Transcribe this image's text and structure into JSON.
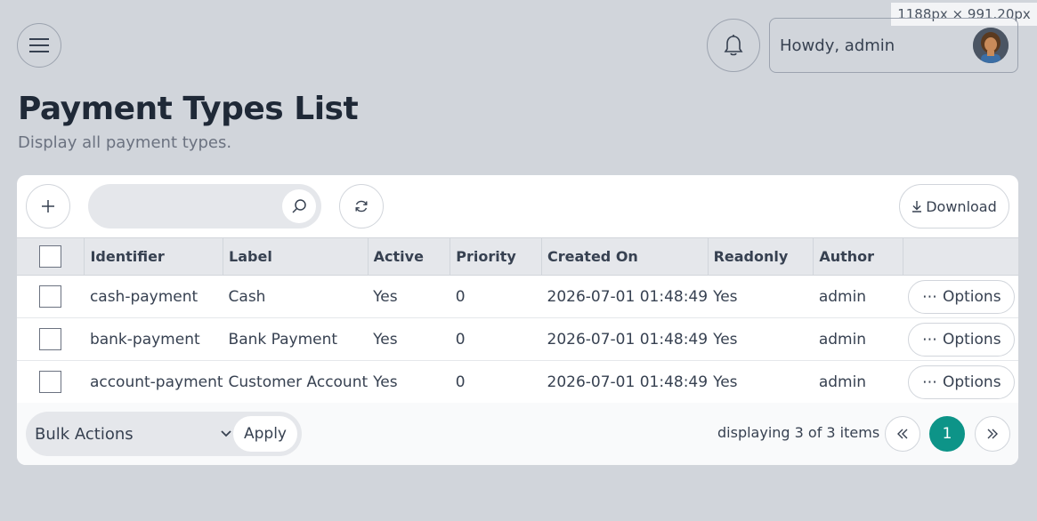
{
  "dimension_badge": "1188px × 991.20px",
  "header": {
    "greeting": "Howdy, admin"
  },
  "page": {
    "title": "Payment Types List",
    "subtitle": "Display all payment types."
  },
  "toolbar": {
    "search_placeholder": "",
    "download_label": "Download"
  },
  "table": {
    "columns": [
      "Identifier",
      "Label",
      "Active",
      "Priority",
      "Created On",
      "Readonly",
      "Author"
    ],
    "rows": [
      {
        "identifier": "cash-payment",
        "label": "Cash",
        "active": "Yes",
        "priority": "0",
        "created_on": "2026-07-01 01:48:49",
        "readonly": "Yes",
        "author": "admin",
        "options": "Options"
      },
      {
        "identifier": "bank-payment",
        "label": "Bank Payment",
        "active": "Yes",
        "priority": "0",
        "created_on": "2026-07-01 01:48:49",
        "readonly": "Yes",
        "author": "admin",
        "options": "Options"
      },
      {
        "identifier": "account-payment",
        "label": "Customer Account",
        "active": "Yes",
        "priority": "0",
        "created_on": "2026-07-01 01:48:49",
        "readonly": "Yes",
        "author": "admin",
        "options": "Options"
      }
    ]
  },
  "footer": {
    "bulk_actions": "Bulk Actions",
    "apply": "Apply",
    "paging_info": "displaying 3 of 3 items",
    "current_page": "1"
  },
  "colors": {
    "background": "#d1d5db",
    "accent": "#0d9488"
  },
  "icons": [
    "menu-icon",
    "bell-icon",
    "avatar",
    "plus-icon",
    "search-icon",
    "refresh-icon",
    "download-icon",
    "chevron-down-icon",
    "double-chevron-left-icon",
    "double-chevron-right-icon",
    "ellipsis-icon"
  ]
}
